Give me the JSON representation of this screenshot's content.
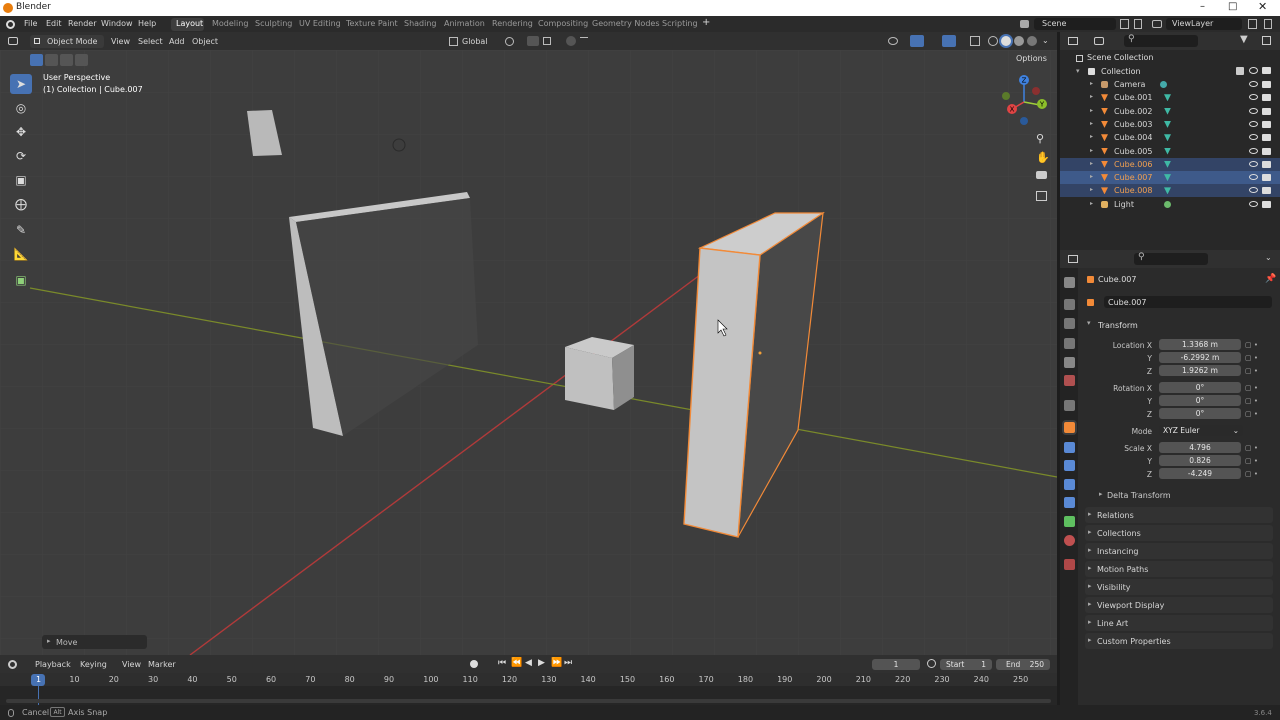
{
  "window": {
    "title": "Blender"
  },
  "menus": [
    "File",
    "Edit",
    "Render",
    "Window",
    "Help"
  ],
  "workspaces": [
    "Layout",
    "Modeling",
    "Sculpting",
    "UV Editing",
    "Texture Paint",
    "Shading",
    "Animation",
    "Rendering",
    "Compositing",
    "Geometry Nodes",
    "Scripting"
  ],
  "active_workspace": "Layout",
  "scene": {
    "name": "Scene",
    "view_layer": "ViewLayer"
  },
  "viewport_header": {
    "mode": "Object Mode",
    "menus": [
      "View",
      "Select",
      "Add",
      "Object"
    ],
    "orientation": "Global",
    "options": "Options"
  },
  "viewport_overlay": {
    "perspective": "User Perspective",
    "context": "(1) Collection | Cube.007",
    "last_op": "Move"
  },
  "gizmo_axes": {
    "x": "X",
    "y": "Y",
    "z": "Z"
  },
  "outliner": {
    "root": "Scene Collection",
    "collection": "Collection",
    "items": [
      {
        "name": "Camera",
        "type": "camera",
        "state": "normal"
      },
      {
        "name": "Cube.001",
        "type": "mesh",
        "state": "normal"
      },
      {
        "name": "Cube.002",
        "type": "mesh",
        "state": "normal"
      },
      {
        "name": "Cube.003",
        "type": "mesh",
        "state": "normal"
      },
      {
        "name": "Cube.004",
        "type": "mesh",
        "state": "normal"
      },
      {
        "name": "Cube.005",
        "type": "mesh",
        "state": "normal"
      },
      {
        "name": "Cube.006",
        "type": "mesh",
        "state": "selected"
      },
      {
        "name": "Cube.007",
        "type": "mesh",
        "state": "active"
      },
      {
        "name": "Cube.008",
        "type": "mesh",
        "state": "selected"
      },
      {
        "name": "Light",
        "type": "light",
        "state": "normal"
      }
    ]
  },
  "properties": {
    "object_name": "Cube.007",
    "data_name": "Cube.007",
    "transform_label": "Transform",
    "location_label": "Location X",
    "location": {
      "x": "1.3368 m",
      "y": "-6.2992 m",
      "z": "1.9262 m"
    },
    "rotation_label": "Rotation X",
    "rotation": {
      "x": "0°",
      "y": "0°",
      "z": "0°"
    },
    "mode_label": "Mode",
    "mode_value": "XYZ Euler",
    "scale_label": "Scale X",
    "scale": {
      "x": "4.796",
      "y": "0.826",
      "z": "-4.249"
    },
    "axis_y": "Y",
    "axis_z": "Z",
    "delta_label": "Delta Transform",
    "sections": [
      "Relations",
      "Collections",
      "Instancing",
      "Motion Paths",
      "Visibility",
      "Viewport Display",
      "Line Art",
      "Custom Properties"
    ]
  },
  "timeline": {
    "menus": [
      "Playback",
      "Keying",
      "View",
      "Marker"
    ],
    "current_frame": "1",
    "start_label": "Start",
    "start": "1",
    "end_label": "End",
    "end": "250",
    "ticks": [
      "10",
      "20",
      "30",
      "40",
      "50",
      "60",
      "70",
      "80",
      "90",
      "100",
      "110",
      "120",
      "130",
      "140",
      "150",
      "160",
      "170",
      "180",
      "190",
      "200",
      "210",
      "220",
      "230",
      "240",
      "250"
    ],
    "playhead": "1"
  },
  "statusbar": {
    "cancel": "Cancel",
    "alt": "Alt",
    "axis_snap": "Axis Snap",
    "version": "3.6.4"
  },
  "colors": {
    "accent": "#4772b3",
    "selection_outline": "#f28a38",
    "active_row": "#3e5a8a",
    "x_axis": "#e04444",
    "y_axis": "#9fcf3a",
    "z_axis": "#3f82e0"
  }
}
